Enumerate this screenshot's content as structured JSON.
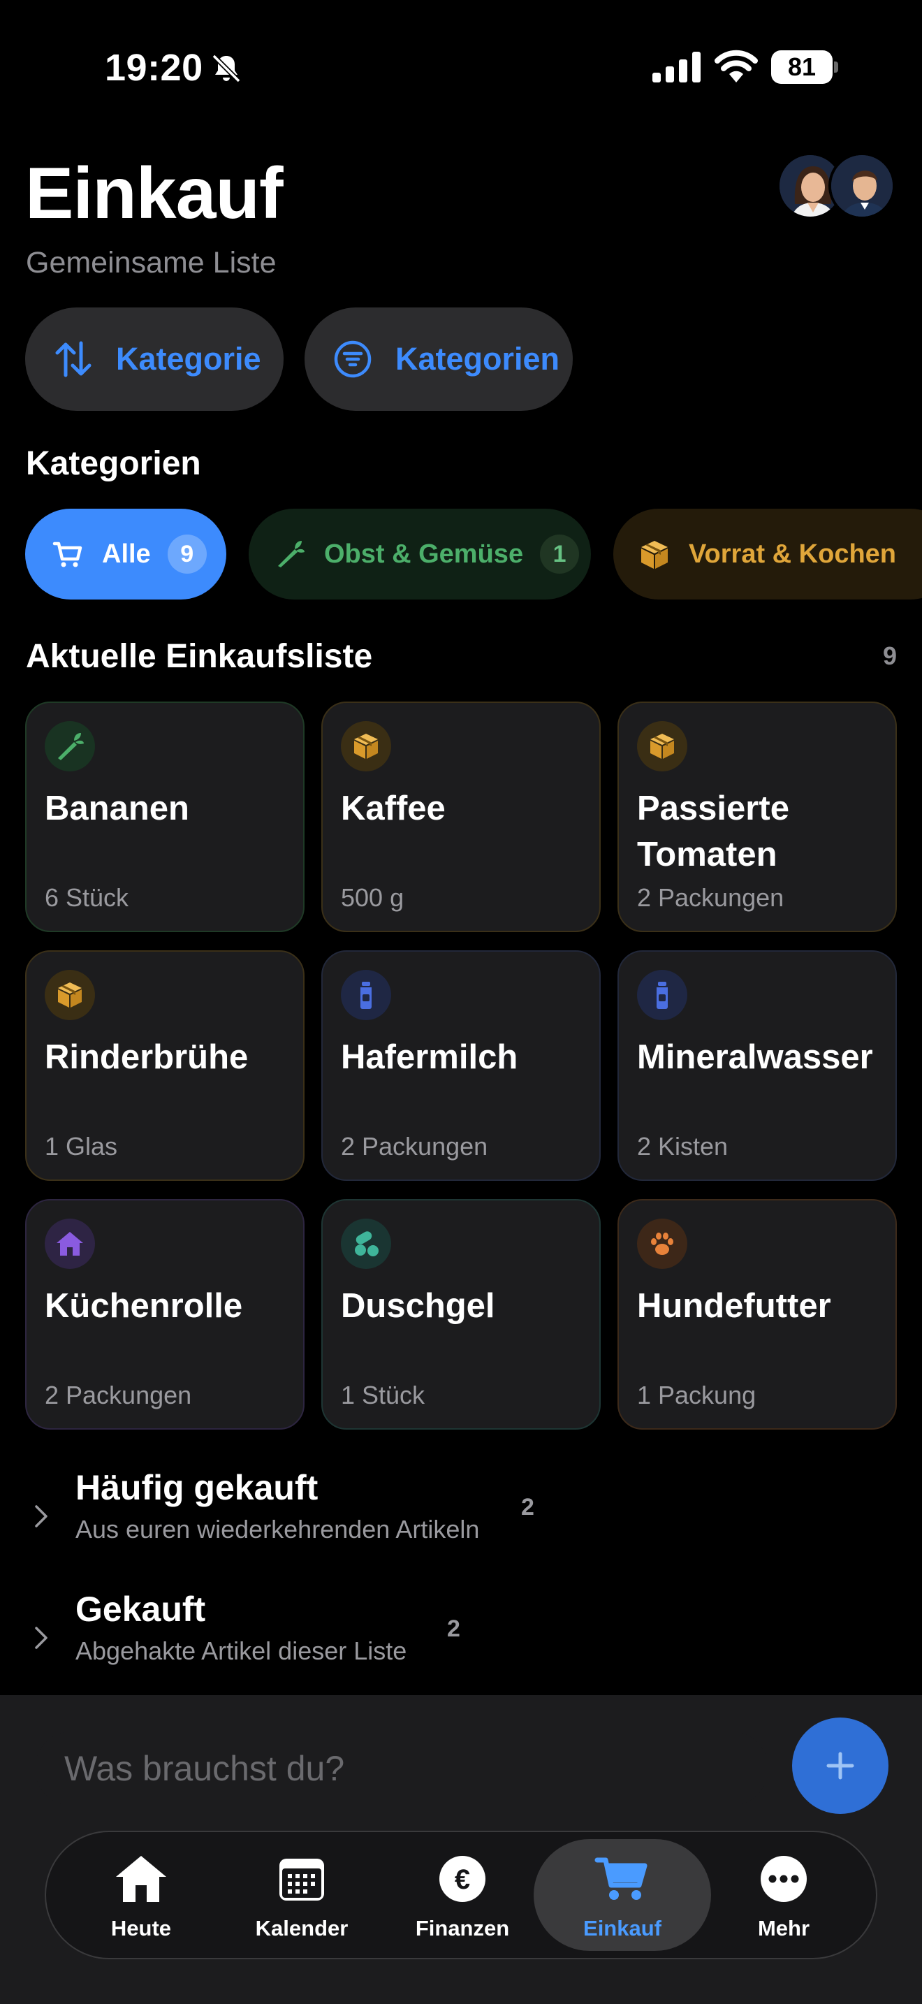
{
  "status_bar": {
    "time": "19:20",
    "battery": "81"
  },
  "header": {
    "title": "Einkauf",
    "subtitle": "Gemeinsame Liste"
  },
  "actions": {
    "sort_label": "Kategorie",
    "filter_label": "Kategorien"
  },
  "categories": {
    "heading": "Kategorien",
    "chips": [
      {
        "label": "Alle",
        "count": "9",
        "icon": "cart-icon",
        "color": "#3d8bfd"
      },
      {
        "label": "Obst & Gemüse",
        "count": "1",
        "icon": "carrot-icon",
        "color": "#4caf6a"
      },
      {
        "label": "Vorrat & Kochen",
        "icon": "box-icon",
        "color": "#e0a63a"
      }
    ]
  },
  "list": {
    "heading": "Aktuelle Einkaufsliste",
    "count": "9",
    "items": [
      {
        "name": "Bananen",
        "qty": "6 Stück",
        "icon": "carrot-icon",
        "category": "produce"
      },
      {
        "name": "Kaffee",
        "qty": "500 g",
        "icon": "box-icon",
        "category": "pantry"
      },
      {
        "name": "Passierte Tomaten",
        "qty": "2 Packungen",
        "icon": "box-icon",
        "category": "pantry"
      },
      {
        "name": "Rinderbrühe",
        "qty": "1 Glas",
        "icon": "box-icon",
        "category": "pantry"
      },
      {
        "name": "Hafermilch",
        "qty": "2 Packungen",
        "icon": "bottle-icon",
        "category": "drinks"
      },
      {
        "name": "Mineralwasser",
        "qty": "2 Kisten",
        "icon": "bottle-icon",
        "category": "drinks"
      },
      {
        "name": "Küchenrolle",
        "qty": "2 Packungen",
        "icon": "house-icon",
        "category": "household"
      },
      {
        "name": "Duschgel",
        "qty": "1 Stück",
        "icon": "pills-icon",
        "category": "care"
      },
      {
        "name": "Hundefutter",
        "qty": "1 Packung",
        "icon": "paw-icon",
        "category": "pet"
      }
    ]
  },
  "sections": [
    {
      "title": "Häufig gekauft",
      "subtitle": "Aus euren wiederkehrenden Artikeln",
      "count": "2"
    },
    {
      "title": "Gekauft",
      "subtitle": "Abgehakte Artikel dieser Liste",
      "count": "2"
    }
  ],
  "composer": {
    "placeholder": "Was brauchst du?"
  },
  "tabbar": {
    "tabs": [
      {
        "label": "Heute",
        "icon": "home-icon"
      },
      {
        "label": "Kalender",
        "icon": "calendar-icon"
      },
      {
        "label": "Finanzen",
        "icon": "euro-icon"
      },
      {
        "label": "Einkauf",
        "icon": "cart-icon",
        "active": true
      },
      {
        "label": "Mehr",
        "icon": "more-icon"
      }
    ]
  },
  "colors": {
    "accent": "#3d8bfd",
    "produce": "#4caf6a",
    "pantry": "#e0a63a",
    "drinks": "#4a6ee0",
    "household": "#8a5be0",
    "care": "#3fb59a",
    "pet": "#e8823a"
  }
}
